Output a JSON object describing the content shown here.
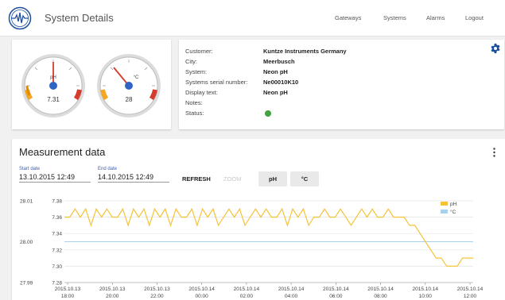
{
  "header": {
    "title": "System Details",
    "nav": [
      "Gateways",
      "Systems",
      "Alarms",
      "Logout"
    ]
  },
  "gauges": [
    {
      "unit": "pH",
      "value": "7.31",
      "level": 0.52
    },
    {
      "unit": "°C",
      "value": "28",
      "level": 0.33
    }
  ],
  "info": [
    {
      "label": "Customer:",
      "value": "Kuntze Instruments Germany"
    },
    {
      "label": "City:",
      "value": "Meerbusch"
    },
    {
      "label": "System:",
      "value": "Neon pH"
    },
    {
      "label": "Systems serial number:",
      "value": "Ne00010K10"
    },
    {
      "label": "Display text:",
      "value": "Neon pH"
    },
    {
      "label": "Notes:",
      "value": ""
    },
    {
      "label": "Status:",
      "value": ""
    }
  ],
  "measurement": {
    "title": "Measurement data",
    "start_label": "Start date",
    "start_value": "13.10.2015 12:49",
    "end_label": "End date",
    "end_value": "14.10.2015 12:49",
    "refresh_label": "REFRESH",
    "zoom_label": "ZOOM",
    "buttons": [
      "pH",
      "°C"
    ]
  },
  "colors": {
    "ph_series": "#f5c338",
    "temp_series": "#a8d1ee",
    "status_ok": "#3fa33f",
    "accent": "#1c4f9c"
  },
  "chart_data": {
    "type": "line",
    "y_left_ticks": [
      "28.01",
      "28.00",
      "27.99"
    ],
    "y_left_ylim": [
      27.99,
      28.01
    ],
    "y_right_ticks": [
      "7.38",
      "7.36",
      "7.34",
      "7.32",
      "7.30",
      "7.28"
    ],
    "y_right_ylim": [
      7.28,
      7.38
    ],
    "x_ticks": [
      [
        "2015.10.13",
        "18:00"
      ],
      [
        "2015.10.13",
        "20:00"
      ],
      [
        "2015.10.13",
        "22:00"
      ],
      [
        "2015.10.14",
        "00:00"
      ],
      [
        "2015.10.14",
        "02:00"
      ],
      [
        "2015.10.14",
        "04:00"
      ],
      [
        "2015.10.14",
        "06:00"
      ],
      [
        "2015.10.14",
        "08:00"
      ],
      [
        "2015.10.14",
        "10:00"
      ],
      [
        "2015.10.14",
        "12:00"
      ]
    ],
    "series": [
      {
        "name": "pH",
        "axis": "right",
        "values": [
          7.36,
          7.36,
          7.37,
          7.36,
          7.37,
          7.35,
          7.37,
          7.36,
          7.37,
          7.36,
          7.36,
          7.37,
          7.35,
          7.37,
          7.36,
          7.37,
          7.35,
          7.37,
          7.36,
          7.37,
          7.35,
          7.37,
          7.36,
          7.36,
          7.37,
          7.35,
          7.37,
          7.36,
          7.37,
          7.35,
          7.36,
          7.37,
          7.36,
          7.37,
          7.35,
          7.36,
          7.37,
          7.36,
          7.37,
          7.36,
          7.36,
          7.37,
          7.35,
          7.37,
          7.36,
          7.37,
          7.35,
          7.36,
          7.36,
          7.37,
          7.36,
          7.36,
          7.37,
          7.36,
          7.35,
          7.36,
          7.37,
          7.36,
          7.37,
          7.36,
          7.36,
          7.37,
          7.36,
          7.36,
          7.36,
          7.35,
          7.35,
          7.34,
          7.33,
          7.32,
          7.31,
          7.31,
          7.3,
          7.3,
          7.3,
          7.31,
          7.31,
          7.31
        ]
      },
      {
        "name": "°C",
        "axis": "left",
        "values": [
          28.0,
          28.0,
          28.0,
          28.0,
          28.0,
          28.0,
          28.0,
          28.0,
          28.0,
          28.0
        ]
      }
    ]
  }
}
